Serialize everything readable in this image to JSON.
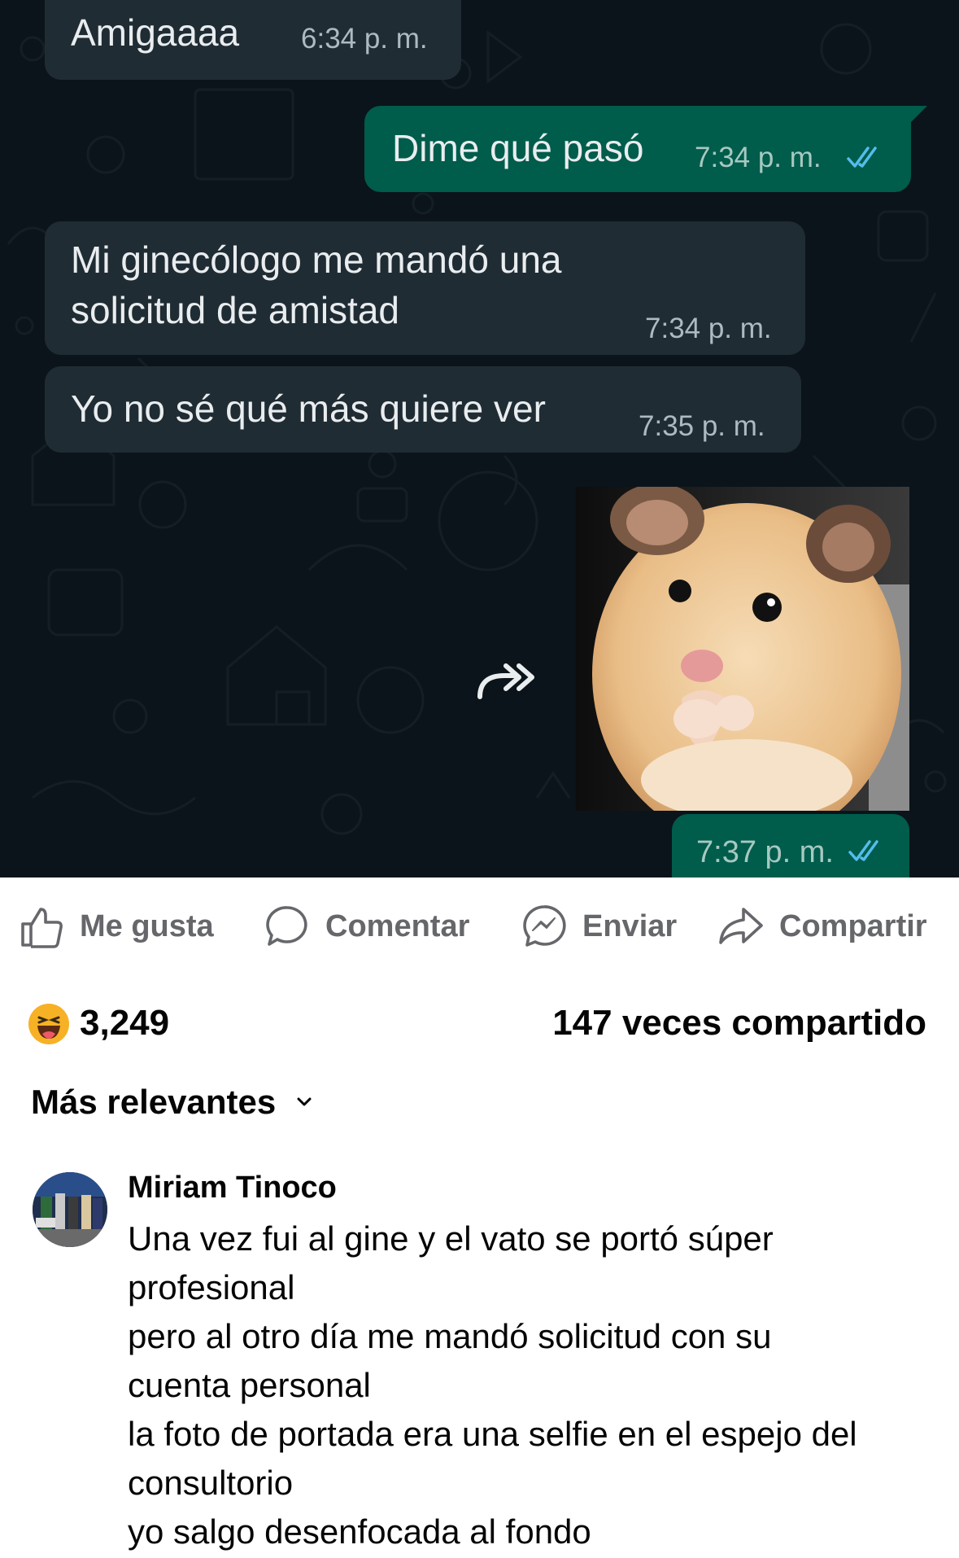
{
  "chat": {
    "messages": [
      {
        "direction": "incoming",
        "text": "Amigaaaa",
        "time": "6:34 p. m."
      },
      {
        "direction": "outgoing",
        "text": "Dime qué pasó",
        "time": "7:34 p. m.",
        "status": "read"
      },
      {
        "direction": "incoming",
        "text": "Mi ginecólogo me mandó una solicitud de amistad",
        "time": "7:34 p. m."
      },
      {
        "direction": "incoming",
        "text": "Yo no sé qué más quiere ver",
        "time": "7:35 p. m."
      },
      {
        "direction": "outgoing",
        "type": "sticker",
        "image": "hamster-covering-mouth",
        "time": "7:37 p. m.",
        "status": "read"
      }
    ],
    "colors": {
      "background": "#0b141a",
      "incoming": "#202c33",
      "outgoing": "#005c4b",
      "read_ticks": "#53bdeb"
    }
  },
  "post_actions": {
    "like": {
      "label": "Me gusta",
      "icon": "thumbs-up-icon"
    },
    "comment": {
      "label": "Comentar",
      "icon": "speech-bubble-icon"
    },
    "send": {
      "label": "Enviar",
      "icon": "messenger-icon"
    },
    "share": {
      "label": "Compartir",
      "icon": "share-arrow-icon"
    }
  },
  "stats": {
    "reaction_icon": "haha-emoji-icon",
    "reaction_count": "3,249",
    "shares": "147 veces compartido"
  },
  "comments_sort": {
    "label": "Más relevantes"
  },
  "comment": {
    "author": "Miriam Tinoco",
    "lines": [
      "Una vez fui al gine y el vato se portó súper",
      "profesional",
      "pero al otro día me mandó solicitud con su",
      "cuenta personal",
      "la foto de portada era una selfie en el espejo del",
      "consultorio",
      "yo salgo desenfocada al fondo"
    ]
  }
}
